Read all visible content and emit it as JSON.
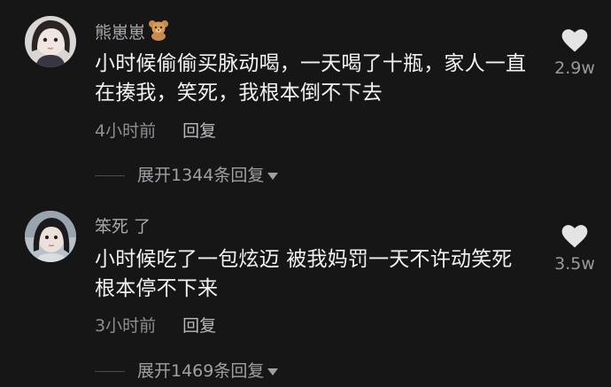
{
  "comments": [
    {
      "author": "熊崽崽",
      "badge_icon": "teddy-bear-icon",
      "text": "小时候偷偷买脉动喝，一天喝了十瓶，家人一直在揍我，笑死，我根本倒不下去",
      "time": "4小时前",
      "reply_label": "回复",
      "like_count": "2.9w",
      "expand_label": "展开1344条回复"
    },
    {
      "author": "笨死 了",
      "text": "小时候吃了一包炫迈 被我妈罚一天不许动笑死 根本停不下来",
      "time": "3小时前",
      "reply_label": "回复",
      "like_count": "3.5w",
      "expand_label": "展开1469条回复"
    }
  ],
  "colors": {
    "background": "#161616",
    "text_primary": "#f2f2f2",
    "text_secondary": "#8e8e93",
    "like_icon": "#e4e4e6"
  }
}
